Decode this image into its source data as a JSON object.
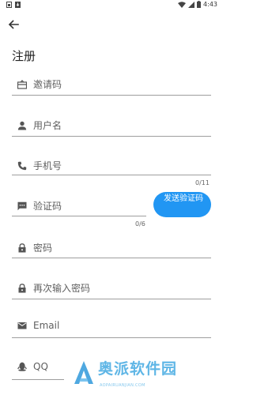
{
  "status_bar": {
    "time": "4:43"
  },
  "header": {
    "title": "注册"
  },
  "form": {
    "invite_code": {
      "placeholder": "邀请码"
    },
    "username": {
      "placeholder": "用户名"
    },
    "phone": {
      "placeholder": "手机号",
      "counter": "0/11"
    },
    "verify_code": {
      "placeholder": "验证码",
      "counter": "0/6",
      "send_button": "发送验证码"
    },
    "password": {
      "placeholder": "密码"
    },
    "confirm_password": {
      "placeholder": "再次输入密码"
    },
    "email": {
      "placeholder": "Email"
    },
    "qq": {
      "placeholder": "QQ"
    }
  },
  "watermark": {
    "text": "奥派软件园",
    "sub": "AOPAIRUANJIAN.COM"
  },
  "colors": {
    "accent": "#2196f3",
    "watermark": "#5fb6e6"
  }
}
